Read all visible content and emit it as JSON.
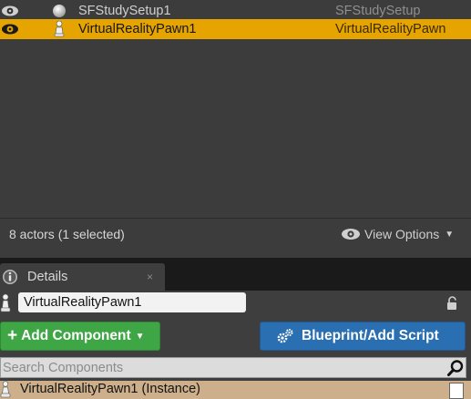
{
  "outliner": {
    "rows": [
      {
        "label": "SFStudySetup1",
        "type": "SFStudySetup",
        "selected": false,
        "icon": "sphere-icon"
      },
      {
        "label": "VirtualRealityPawn1",
        "type": "VirtualRealityPawn",
        "selected": true,
        "icon": "pawn-icon"
      }
    ],
    "status": "8 actors (1 selected)",
    "view_options": "View Options"
  },
  "details": {
    "tab_label": "Details",
    "tab_close": "×",
    "actor_name": "VirtualRealityPawn1",
    "add_component_plus": "+",
    "add_component_label": "Add Component",
    "blueprint_label": "Blueprint/Add Script",
    "search_placeholder": "Search Components",
    "component_row": "VirtualRealityPawn1 (Instance)"
  },
  "colors": {
    "selection": "#e6a400",
    "add_button": "#3fa645",
    "blueprint_button": "#2a6fb2",
    "component_row": "#cdb08b"
  }
}
